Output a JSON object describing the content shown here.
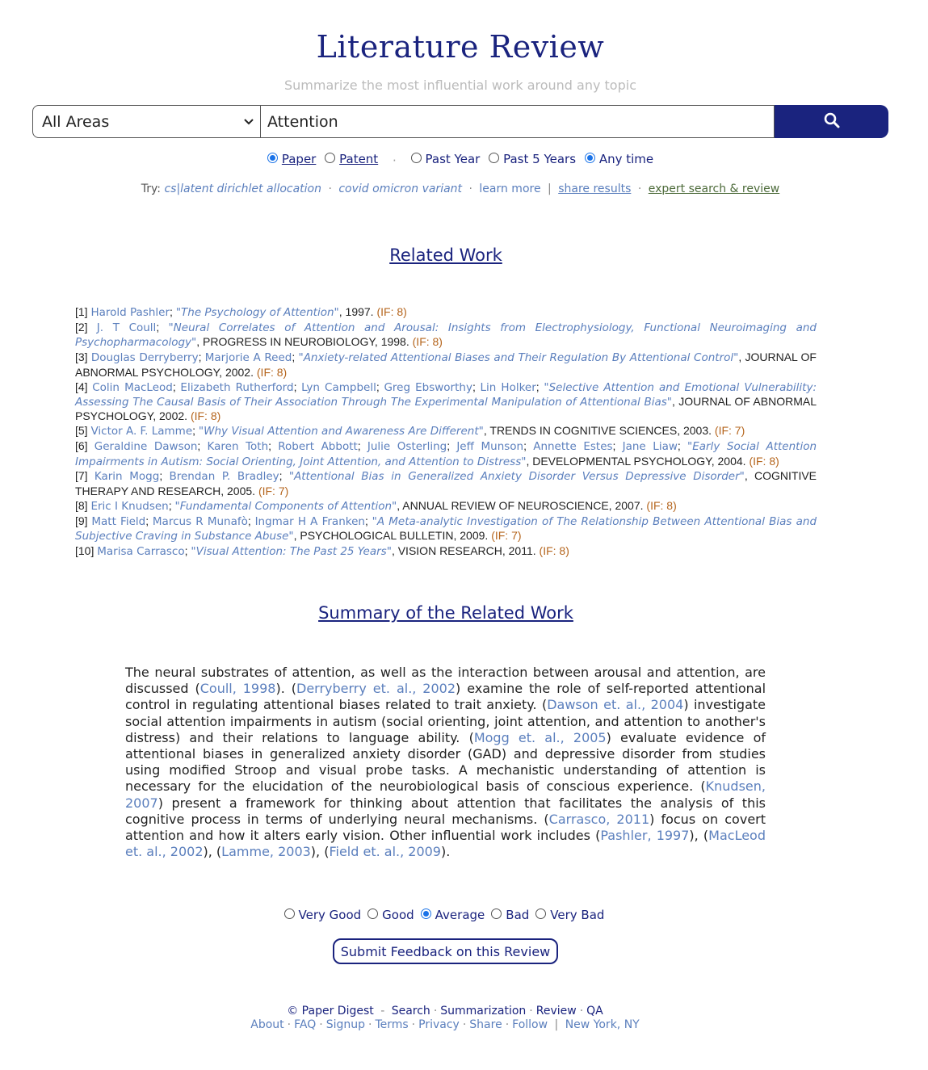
{
  "header": {
    "title": "Literature Review",
    "subtitle": "Summarize the most influential work around any topic"
  },
  "search": {
    "area_value": "All Areas",
    "query": "Attention",
    "button_icon": "search-icon"
  },
  "filters": {
    "type": [
      {
        "label": "Paper",
        "selected": true
      },
      {
        "label": "Patent",
        "selected": false
      }
    ],
    "time": [
      {
        "label": "Past Year",
        "selected": false
      },
      {
        "label": "Past 5 Years",
        "selected": false
      },
      {
        "label": "Any time",
        "selected": true
      }
    ]
  },
  "try_line": {
    "prefix": "Try:",
    "example1": "cs|latent dirichlet allocation",
    "example2": "covid omicron variant",
    "learn_more": "learn more",
    "share": "share results",
    "expert": "expert search & review"
  },
  "related": {
    "title": "Related Work",
    "refs": [
      {
        "num": "[1]",
        "authors": [
          "Harold Pashler"
        ],
        "paper": "\"The Psychology of Attention\"",
        "venue": "",
        "year": "1997.",
        "if": "(IF: 8)"
      },
      {
        "num": "[2]",
        "authors": [
          "J. T Coull"
        ],
        "paper": "\"Neural Correlates of Attention and Arousal: Insights from Electrophysiology, Functional Neuroimaging and Psychopharmacology\"",
        "venue": "PROGRESS IN NEUROBIOLOGY,",
        "year": "1998.",
        "if": "(IF: 8)"
      },
      {
        "num": "[3]",
        "authors": [
          "Douglas Derryberry",
          "Marjorie A Reed"
        ],
        "paper": "\"Anxiety-related Attentional Biases and Their Regulation By Attentional Control\"",
        "venue": "JOURNAL OF ABNORMAL PSYCHOLOGY,",
        "year": "2002.",
        "if": "(IF: 8)"
      },
      {
        "num": "[4]",
        "authors": [
          "Colin MacLeod",
          "Elizabeth Rutherford",
          "Lyn Campbell",
          "Greg Ebsworthy",
          "Lin Holker"
        ],
        "paper": "\"Selective Attention and Emotional Vulnerability: Assessing The Causal Basis of Their Association Through The Experimental Manipulation of Attentional Bias\"",
        "venue": "JOURNAL OF ABNORMAL PSYCHOLOGY,",
        "year": "2002.",
        "if": "(IF: 8)"
      },
      {
        "num": "[5]",
        "authors": [
          "Victor A. F. Lamme"
        ],
        "paper": "\"Why Visual Attention and Awareness Are Different\"",
        "venue": "TRENDS IN COGNITIVE SCIENCES,",
        "year": "2003.",
        "if": "(IF: 7)"
      },
      {
        "num": "[6]",
        "authors": [
          "Geraldine Dawson",
          "Karen Toth",
          "Robert Abbott",
          "Julie Osterling",
          "Jeff Munson",
          "Annette Estes",
          "Jane Liaw"
        ],
        "paper": "\"Early Social Attention Impairments in Autism: Social Orienting, Joint Attention, and Attention to Distress\"",
        "venue": "DEVELOPMENTAL PSYCHOLOGY,",
        "year": "2004.",
        "if": "(IF: 8)"
      },
      {
        "num": "[7]",
        "authors": [
          "Karin Mogg",
          "Brendan P. Bradley"
        ],
        "paper": "\"Attentional Bias in Generalized Anxiety Disorder Versus Depressive Disorder\"",
        "venue": "COGNITIVE THERAPY AND RESEARCH,",
        "year": "2005.",
        "if": "(IF: 7)"
      },
      {
        "num": "[8]",
        "authors": [
          "Eric I Knudsen"
        ],
        "paper": "\"Fundamental Components of Attention\"",
        "venue": "ANNUAL REVIEW OF NEUROSCIENCE,",
        "year": "2007.",
        "if": "(IF: 8)"
      },
      {
        "num": "[9]",
        "authors": [
          "Matt Field",
          "Marcus R Munafò",
          "Ingmar H A Franken"
        ],
        "paper": "\"A Meta-analytic Investigation of The Relationship Between Attentional Bias and Subjective Craving in Substance Abuse\"",
        "venue": "PSYCHOLOGICAL BULLETIN,",
        "year": "2009.",
        "if": "(IF: 7)"
      },
      {
        "num": "[10]",
        "authors": [
          "Marisa Carrasco"
        ],
        "paper": "\"Visual Attention: The Past 25 Years\"",
        "venue": "VISION RESEARCH,",
        "year": "2011.",
        "if": "(IF: 8)"
      }
    ]
  },
  "summary": {
    "title": "Summary of the Related Work",
    "parts": [
      {
        "t": "The neural substrates of attention, as well as the interaction between arousal and attention, are discussed ("
      },
      {
        "c": "Coull, 1998"
      },
      {
        "t": "). ("
      },
      {
        "c": "Derryberry et. al., 2002"
      },
      {
        "t": ") examine the role of self-reported attentional control in regulating attentional biases related to trait anxiety. ("
      },
      {
        "c": "Dawson et. al., 2004"
      },
      {
        "t": ") investigate social attention impairments in autism (social orienting, joint attention, and attention to another's distress) and their relations to language ability. ("
      },
      {
        "c": "Mogg et. al., 2005"
      },
      {
        "t": ") evaluate evidence of attentional biases in generalized anxiety disorder (GAD) and depressive disorder from studies using modified Stroop and visual probe tasks. A mechanistic understanding of attention is necessary for the elucidation of the neurobiological basis of conscious experience. ("
      },
      {
        "c": "Knudsen, 2007"
      },
      {
        "t": ") present a framework for thinking about attention that facilitates the analysis of this cognitive process in terms of underlying neural mechanisms. ("
      },
      {
        "c": "Carrasco, 2011"
      },
      {
        "t": ") focus on covert attention and how it alters early vision. Other influential work includes ("
      },
      {
        "c": "Pashler, 1997"
      },
      {
        "t": "), ("
      },
      {
        "c": "MacLeod et. al., 2002"
      },
      {
        "t": "), ("
      },
      {
        "c": "Lamme, 2003"
      },
      {
        "t": "), ("
      },
      {
        "c": "Field et. al., 2009"
      },
      {
        "t": ")."
      }
    ]
  },
  "feedback": {
    "options": [
      {
        "label": "Very Good",
        "selected": false
      },
      {
        "label": "Good",
        "selected": false
      },
      {
        "label": "Average",
        "selected": true
      },
      {
        "label": "Bad",
        "selected": false
      },
      {
        "label": "Very Bad",
        "selected": false
      }
    ],
    "submit_label": "Submit Feedback on this Review"
  },
  "footer": {
    "copyright": "© Paper Digest",
    "dash": "-",
    "line1_links": [
      "Search",
      "Summarization",
      "Review",
      "QA"
    ],
    "line2_links": [
      "About",
      "FAQ",
      "Signup",
      "Terms",
      "Privacy",
      "Share",
      "Follow"
    ],
    "location": "New York, NY"
  },
  "colors": {
    "brand": "#1a237e",
    "link": "#5b7fbd",
    "impact": "#b5651d"
  }
}
